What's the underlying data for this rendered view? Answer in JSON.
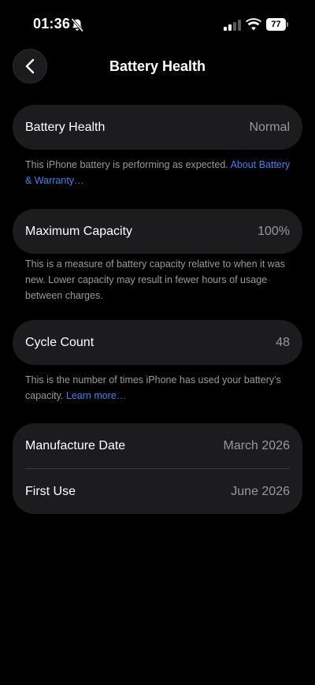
{
  "status_bar": {
    "time": "01:36",
    "battery_level": "77",
    "signal_bars_active": 2,
    "signal_bars_total": 4
  },
  "nav": {
    "title": "Battery Health"
  },
  "battery_health": {
    "label": "Battery Health",
    "value": "Normal",
    "footnote": "This iPhone battery is performing as expected. ",
    "link": "About Battery & Warranty…"
  },
  "maximum_capacity": {
    "label": "Maximum Capacity",
    "value": "100%",
    "footnote": "This is a measure of battery capacity relative to when it was new. Lower capacity may result in fewer hours of usage between charges."
  },
  "cycle_count": {
    "label": "Cycle Count",
    "value": "48",
    "footnote": "This is the number of times iPhone has used your battery’s capacity. ",
    "link": "Learn more…"
  },
  "dates": {
    "manufacture_label": "Manufacture Date",
    "manufacture_value": "March 2026",
    "first_use_label": "First Use",
    "first_use_value": "June 2026"
  },
  "colors": {
    "background": "#000000",
    "card": "#1c1c1e",
    "secondary_text": "#98989f",
    "link": "#3a82f6"
  },
  "icons": {
    "back": "chevron-left-icon",
    "mute": "bell-slash-icon",
    "signal": "cellular-signal-icon",
    "wifi": "wifi-icon",
    "battery": "battery-icon"
  }
}
